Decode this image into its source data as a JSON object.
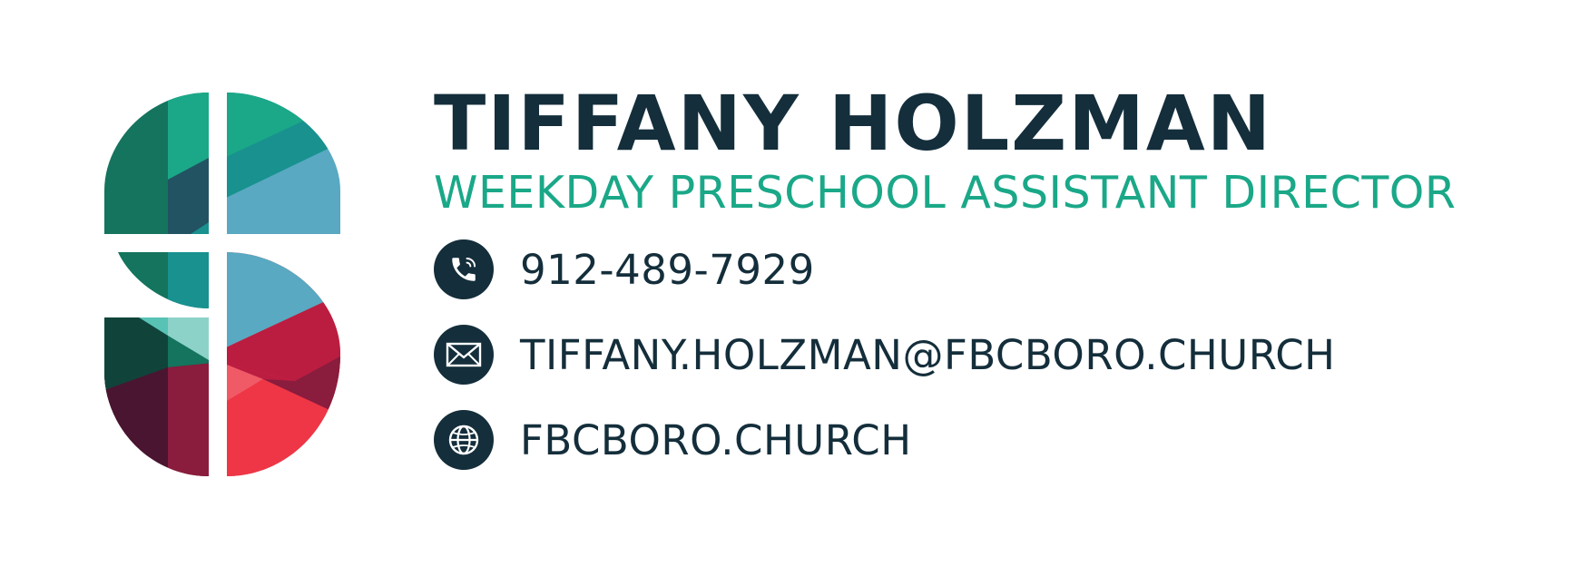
{
  "signature": {
    "name": "TIFFANY HOLZMAN",
    "title": "WEEKDAY PRESCHOOL ASSISTANT DIRECTOR",
    "contacts": [
      {
        "type": "phone",
        "icon": "phone-icon",
        "text": "912-489-7929"
      },
      {
        "type": "email",
        "icon": "envelope-icon",
        "text": "TIFFANY.HOLZMAN@FBCBORO.CHURCH"
      },
      {
        "type": "website",
        "icon": "globe-icon",
        "text": "FBCBORO.CHURCH"
      }
    ]
  },
  "logo": {
    "icon": "church-s-cross-logo",
    "colors": [
      "#14745d",
      "#1aa888",
      "#18918f",
      "#58a9c1",
      "#225362",
      "#10443b",
      "#8cd2c8",
      "#bb1d41",
      "#8a1c3d",
      "#ee3646",
      "#4a1530"
    ]
  },
  "colors": {
    "name": "#142e3b",
    "title": "#1aa888",
    "icon_background": "#142e3b",
    "icon_foreground": "#ffffff",
    "contact_text": "#142e3b"
  }
}
